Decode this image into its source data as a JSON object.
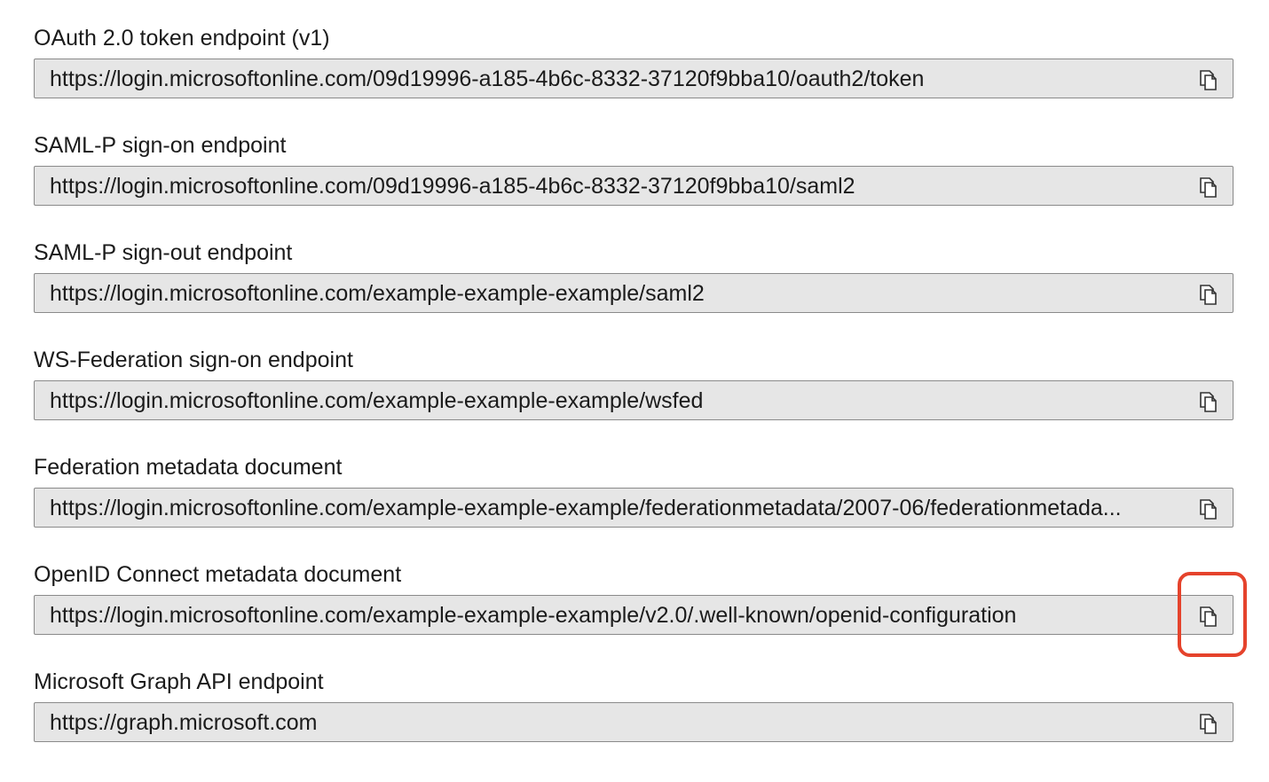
{
  "endpoints": [
    {
      "label": "OAuth 2.0 token endpoint (v1)",
      "value": "https://login.microsoftonline.com/09d19996-a185-4b6c-8332-37120f9bba10/oauth2/token",
      "copy_icon": "copy-icon"
    },
    {
      "label": "SAML-P sign-on endpoint",
      "value": "https://login.microsoftonline.com/09d19996-a185-4b6c-8332-37120f9bba10/saml2",
      "copy_icon": "copy-icon"
    },
    {
      "label": "SAML-P sign-out endpoint",
      "value": "https://login.microsoftonline.com/example-example-example/saml2",
      "copy_icon": "copy-icon"
    },
    {
      "label": "WS-Federation sign-on endpoint",
      "value": "https://login.microsoftonline.com/example-example-example/wsfed",
      "copy_icon": "copy-icon"
    },
    {
      "label": "Federation metadata document",
      "value": "https://login.microsoftonline.com/example-example-example/federationmetadata/2007-06/federationmetada...",
      "copy_icon": "copy-icon"
    },
    {
      "label": "OpenID Connect metadata document",
      "value": "https://login.microsoftonline.com/example-example-example/v2.0/.well-known/openid-configuration",
      "copy_icon": "copy-icon"
    },
    {
      "label": "Microsoft Graph API endpoint",
      "value": "https://graph.microsoft.com",
      "copy_icon": "copy-icon"
    }
  ],
  "highlight": {
    "target": "OpenID Connect metadata document copy button",
    "color": "#e5432c"
  },
  "colors": {
    "field_background": "#e6e6e6",
    "field_border": "#8a8a8a",
    "text": "#1b1b1b",
    "icon": "#333333"
  }
}
